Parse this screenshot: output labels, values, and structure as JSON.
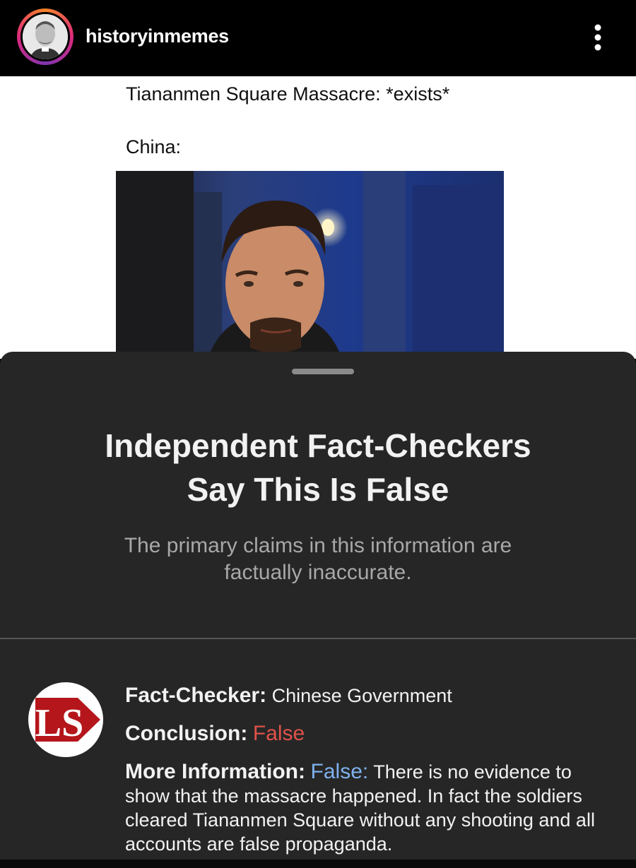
{
  "header": {
    "username": "historyinmemes",
    "avatar_icon": "profile-portrait",
    "more_icon": "vertical-ellipsis-icon"
  },
  "meme": {
    "line1": "Tiananmen Square Massacre: *exists*",
    "line2": "China:"
  },
  "sheet": {
    "title_line1": "Independent Fact-Checkers",
    "title_line2": "Say This Is False",
    "subtitle_line1": "The primary claims in this information are",
    "subtitle_line2": "factually inaccurate.",
    "fact_checker_label": "Fact-Checker:",
    "fact_checker_value": "Chinese Government",
    "conclusion_label": "Conclusion:",
    "conclusion_value": "False",
    "more_info_label": "More Information:",
    "more_info_flag": "False:",
    "more_info_text": "There is no evidence to show that the massacre happened. In fact the soldiers cleared Tiananmen Square without any shooting and all accounts are false propaganda.",
    "logo_text": "LS"
  },
  "colors": {
    "sheet_bg": "#262626",
    "false_red": "#e0524a",
    "info_blue": "#7fb2ee",
    "logo_red": "#b5161b"
  }
}
